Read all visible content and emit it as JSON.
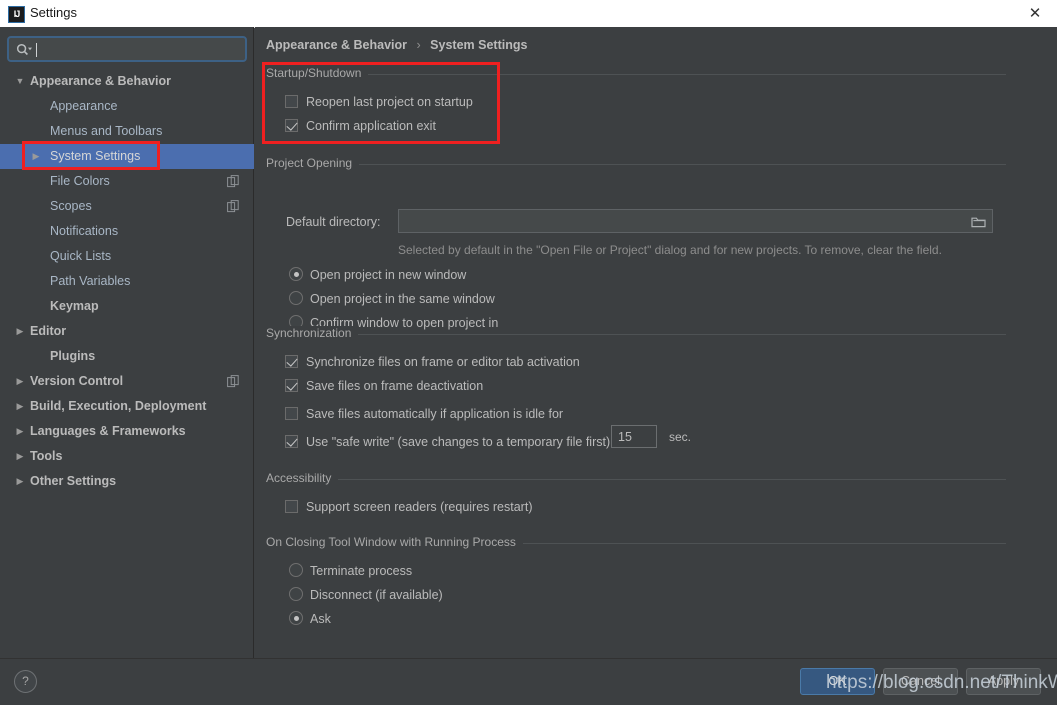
{
  "window": {
    "title": "Settings",
    "app_icon": "IJ",
    "close_label": "✕"
  },
  "search": {
    "value": "",
    "placeholder": "",
    "icon": "search-icon"
  },
  "sidebar": {
    "items": [
      {
        "label": "Appearance & Behavior",
        "level": 0,
        "arrow": "▼",
        "expanded": true,
        "selected": false,
        "badge": ""
      },
      {
        "label": "Appearance",
        "level": 1,
        "arrow": "",
        "expanded": false,
        "selected": false,
        "badge": ""
      },
      {
        "label": "Menus and Toolbars",
        "level": 1,
        "arrow": "",
        "expanded": false,
        "selected": false,
        "badge": ""
      },
      {
        "label": "System Settings",
        "level": 1,
        "arrow": "▶",
        "expanded": false,
        "selected": true,
        "badge": ""
      },
      {
        "label": "File Colors",
        "level": 1,
        "arrow": "",
        "expanded": false,
        "selected": false,
        "badge": "copy-icon"
      },
      {
        "label": "Scopes",
        "level": 1,
        "arrow": "",
        "expanded": false,
        "selected": false,
        "badge": "copy-icon"
      },
      {
        "label": "Notifications",
        "level": 1,
        "arrow": "",
        "expanded": false,
        "selected": false,
        "badge": ""
      },
      {
        "label": "Quick Lists",
        "level": 1,
        "arrow": "",
        "expanded": false,
        "selected": false,
        "badge": ""
      },
      {
        "label": "Path Variables",
        "level": 1,
        "arrow": "",
        "expanded": false,
        "selected": false,
        "badge": ""
      },
      {
        "label": "Keymap",
        "level": "1b",
        "arrow": "",
        "expanded": false,
        "selected": false,
        "badge": ""
      },
      {
        "label": "Editor",
        "level": 0,
        "arrow": "▶",
        "expanded": false,
        "selected": false,
        "badge": ""
      },
      {
        "label": "Plugins",
        "level": "1b",
        "arrow": "",
        "expanded": false,
        "selected": false,
        "badge": ""
      },
      {
        "label": "Version Control",
        "level": 0,
        "arrow": "▶",
        "expanded": false,
        "selected": false,
        "badge": "copy-icon"
      },
      {
        "label": "Build, Execution, Deployment",
        "level": 0,
        "arrow": "▶",
        "expanded": false,
        "selected": false,
        "badge": ""
      },
      {
        "label": "Languages & Frameworks",
        "level": 0,
        "arrow": "▶",
        "expanded": false,
        "selected": false,
        "badge": ""
      },
      {
        "label": "Tools",
        "level": 0,
        "arrow": "▶",
        "expanded": false,
        "selected": false,
        "badge": ""
      },
      {
        "label": "Other Settings",
        "level": 0,
        "arrow": "▶",
        "expanded": false,
        "selected": false,
        "badge": ""
      }
    ]
  },
  "breadcrumb": {
    "root": "Appearance & Behavior",
    "separator": "›",
    "current": "System Settings"
  },
  "groups": {
    "startup": {
      "title": "Startup/Shutdown",
      "reopen_last_project": {
        "label": "Reopen last project on startup",
        "checked": false
      },
      "confirm_exit": {
        "label": "Confirm application exit",
        "checked": true
      }
    },
    "project_opening": {
      "title": "Project Opening",
      "default_directory_label": "Default directory:",
      "default_directory_value": "",
      "browse_icon": "folder-icon",
      "hint": "Selected by default in the \"Open File or Project\" dialog and for new projects. To remove, clear the field.",
      "options": [
        {
          "label": "Open project in new window",
          "selected": true
        },
        {
          "label": "Open project in the same window",
          "selected": false
        },
        {
          "label": "Confirm window to open project in",
          "selected": false
        }
      ]
    },
    "synchronization": {
      "title": "Synchronization",
      "sync_on_frame": {
        "label": "Synchronize files on frame or editor tab activation",
        "checked": true
      },
      "save_on_deactivation": {
        "label": "Save files on frame deactivation",
        "checked": true
      },
      "save_idle": {
        "label": "Save files automatically if application is idle for",
        "checked": false
      },
      "idle_seconds": "15",
      "idle_unit": "sec.",
      "safe_write": {
        "label": "Use \"safe write\" (save changes to a temporary file first)",
        "checked": true
      }
    },
    "accessibility": {
      "title": "Accessibility",
      "screen_readers": {
        "label": "Support screen readers (requires restart)",
        "checked": false
      }
    },
    "closing_tool_window": {
      "title": "On Closing Tool Window with Running Process",
      "options": [
        {
          "label": "Terminate process",
          "selected": false
        },
        {
          "label": "Disconnect (if available)",
          "selected": false
        },
        {
          "label": "Ask",
          "selected": true
        }
      ]
    }
  },
  "footer": {
    "help_label": "?",
    "ok_label": "OK",
    "cancel_label": "Cancel",
    "apply_label": "Apply"
  },
  "annotations": {
    "watermark": "https://blog.csdn.net/ThinkWon",
    "highlight_color": "#ef2020"
  }
}
